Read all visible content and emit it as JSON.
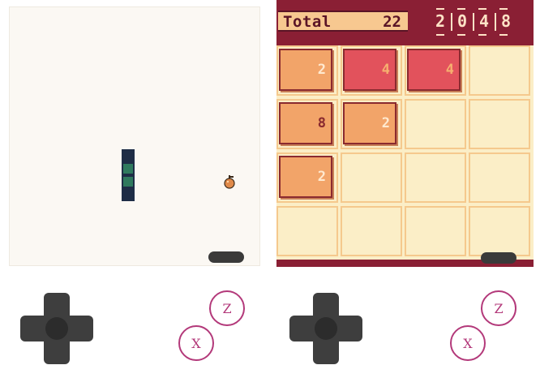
{
  "snake_game": {
    "colors": {
      "background": "#fbf8f3",
      "snake_head": "#1e2d46",
      "snake_body": "#2f7a5e",
      "food": "#e08a4a"
    },
    "food_icon": "apple-icon"
  },
  "puzzle_2048": {
    "total_label": "Total",
    "total_value": "22",
    "best_digits": [
      "2",
      "0",
      "4",
      "8"
    ],
    "grid": [
      [
        "2",
        "4",
        "4",
        ""
      ],
      [
        "8",
        "2",
        "",
        ""
      ],
      [
        "2",
        "",
        "",
        ""
      ],
      [
        "",
        "",
        "",
        ""
      ]
    ],
    "colors": {
      "frame": "#8a1f34",
      "board": "#fbeec7",
      "tile_low": "#f2a469",
      "tile_4": "#e2525c",
      "text_low": "#ffe9cf",
      "text_4": "#f6b06f",
      "text_8": "#8a2a2f"
    }
  },
  "controls": {
    "left": {
      "button_z": "Z",
      "button_x": "X"
    },
    "right": {
      "button_z": "Z",
      "button_x": "X"
    }
  }
}
